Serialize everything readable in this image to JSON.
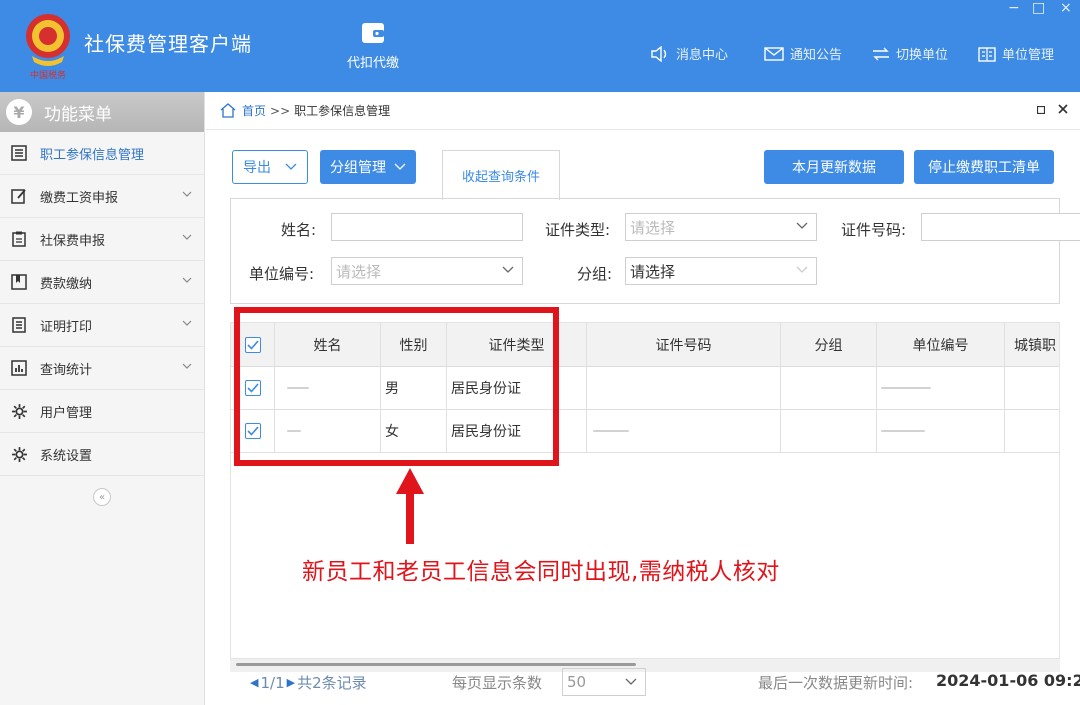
{
  "header": {
    "app_title": "社保费管理客户端",
    "module_label": "代扣代缴",
    "logo_text": "中国税务",
    "nav": [
      "消息中心",
      "通知公告",
      "切换单位",
      "单位管理"
    ],
    "window_controls": [
      "−",
      "□",
      "×"
    ]
  },
  "sidebar": {
    "title": "功能菜单",
    "items": [
      {
        "label": "职工参保信息管理",
        "icon": "list-icon",
        "has_chevron": false,
        "active": true
      },
      {
        "label": "缴费工资申报",
        "icon": "edit-icon",
        "has_chevron": true
      },
      {
        "label": "社保费申报",
        "icon": "clipboard-icon",
        "has_chevron": true
      },
      {
        "label": "费款缴纳",
        "icon": "bookmark-icon",
        "has_chevron": true
      },
      {
        "label": "证明打印",
        "icon": "document-icon",
        "has_chevron": true
      },
      {
        "label": "查询统计",
        "icon": "chart-icon",
        "has_chevron": true
      },
      {
        "label": "用户管理",
        "icon": "gear-icon",
        "has_chevron": false
      },
      {
        "label": "系统设置",
        "icon": "gear-icon",
        "has_chevron": false
      }
    ],
    "collapse_glyph": "«"
  },
  "breadcrumb": {
    "home": "首页",
    "sep": ">>",
    "current": "职工参保信息管理"
  },
  "toolbar": {
    "export_label": "导出",
    "group_label": "分组管理",
    "collapse_query_label": "收起查询条件",
    "update_label": "本月更新数据",
    "stop_list_label": "停止缴费职工清单"
  },
  "search": {
    "name_label": "姓名:",
    "name_value": "",
    "id_type_label": "证件类型:",
    "id_type_placeholder": "请选择",
    "id_no_label": "证件号码:",
    "id_no_value": "",
    "unit_no_label": "单位编号:",
    "unit_no_placeholder": "请选择",
    "group_label": "分组:",
    "group_value": "请选择"
  },
  "table": {
    "columns": [
      "姓名",
      "性别",
      "证件类型",
      "证件号码",
      "分组",
      "单位编号",
      "城镇职"
    ],
    "rows": [
      {
        "name": "",
        "gender": "男",
        "id_type": "居民身份证",
        "id_no": "",
        "group": "",
        "unit_no": "",
        "checked": true
      },
      {
        "name": "",
        "gender": "女",
        "id_type": "居民身份证",
        "id_no": "",
        "group": "",
        "unit_no": "",
        "checked": true
      }
    ]
  },
  "pager": {
    "page": "1/1",
    "total": "共2条记录",
    "per_page_label": "每页显示条数",
    "per_page_value": "50",
    "last_update_label": "最后一次数据更新时间:",
    "last_update_value": "2024-01-06 09:2"
  },
  "annotation": {
    "text": "新员工和老员工信息会同时出现,需纳税人核对",
    "color": "#e0141b"
  },
  "colors": {
    "brand": "#3d8be4",
    "link": "#2f74c8"
  }
}
